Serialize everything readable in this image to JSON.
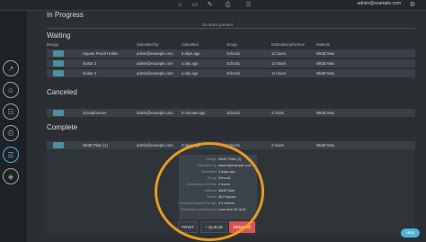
{
  "topbar": {
    "icons": [
      "home-icon",
      "tray-icon",
      "tools-icon",
      "printer-icon",
      "queue-icon"
    ],
    "user_email": "admin@example.com"
  },
  "sidebar": {
    "icons": [
      "chart-icon",
      "user-icon",
      "group-icon",
      "printer-icon",
      "list-icon",
      "layers-icon"
    ]
  },
  "sections": {
    "in_progress": {
      "title": "In Progress",
      "empty_note": "No items present"
    },
    "waiting": {
      "title": "Waiting"
    },
    "canceled": {
      "title": "Canceled"
    },
    "complete": {
      "title": "Complete"
    }
  },
  "columns": {
    "design": "Design",
    "submitted_by": "Submitted by",
    "submitted": "Submitted",
    "group": "Group",
    "estimated_print_time": "Estimated print time",
    "material": "Material"
  },
  "waiting_rows": [
    {
      "name": "Square Pencil Holder",
      "submitted_by": "admin@example.com",
      "submitted": "5 days ago",
      "group": "School1",
      "time": "11 hours",
      "material": "Mk3D Max"
    },
    {
      "name": "Guitar 3",
      "submitted_by": "admin@example.com",
      "submitted": "a day ago",
      "group": "School1",
      "time": "11 hours",
      "material": "Mk3D Max"
    },
    {
      "name": "Guitar 2",
      "submitted_by": "admin@example.com",
      "submitted": "a day ago",
      "group": "School1",
      "time": "11 hours",
      "material": "Mk3D Max"
    }
  ],
  "canceled_rows": [
    {
      "name": "Octosphenoer",
      "submitted_by": "admin@example.com",
      "submitted": "6 minutes ago",
      "group": "School1",
      "time": "4 hours",
      "material": "Mk3D Max"
    }
  ],
  "complete_rows": [
    {
      "name": "Mk3D Plate (1)",
      "submitted_by": "admin@example.com",
      "submitted": "3 days ago",
      "group": "School1",
      "time": "2 hours",
      "material": "Mk3D Max"
    }
  ],
  "details": [
    {
      "label": "Design",
      "value": "Mk3D Plate (1)"
    },
    {
      "label": "Submitted by",
      "value": "admin@example.com"
    },
    {
      "label": "Submitted",
      "value": "3 days ago"
    },
    {
      "label": "Group",
      "value": "School1"
    },
    {
      "label": "Estimated print time",
      "value": "2 hours"
    },
    {
      "label": "Material",
      "value": "Mk3D Max"
    },
    {
      "label": "Printer",
      "value": "All Purpose"
    },
    {
      "label": "Estimated filament length",
      "value": "5.3 meters"
    },
    {
      "label": "Estimated material cost",
      "value": "Less than $1 AUD"
    }
  ],
  "buttons": {
    "print": "PRINT",
    "queue": "+ QUEUE",
    "remove": "REMOVE"
  },
  "help": {
    "label": "Help"
  },
  "colors": {
    "accent": "#4fb3d9",
    "danger": "#d9534f",
    "highlight": "#f0a020"
  }
}
